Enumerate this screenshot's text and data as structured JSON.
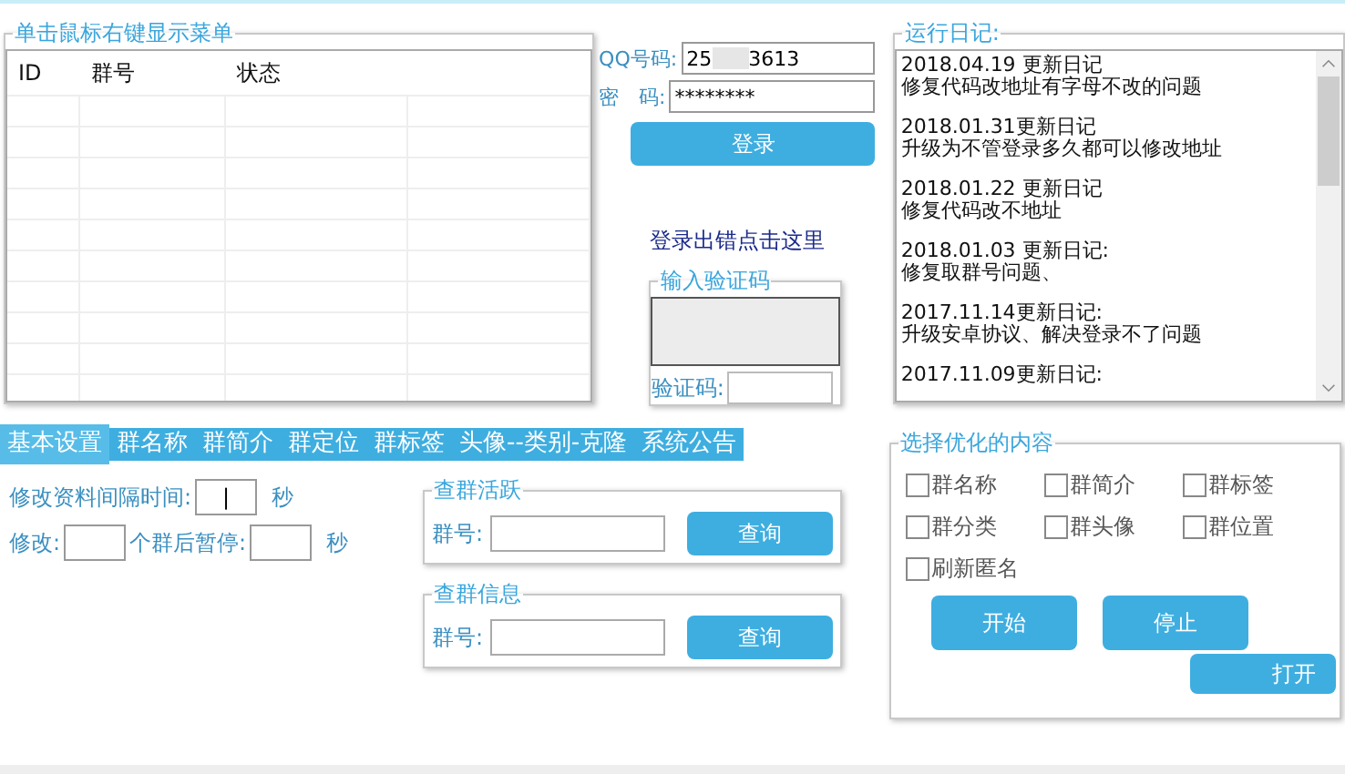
{
  "group_table": {
    "legend": "单击鼠标右键显示菜单",
    "columns": [
      "ID",
      "群号",
      "状态"
    ]
  },
  "login": {
    "qq_label": "QQ号码:",
    "qq_value_start": "25",
    "qq_value_end": "3613",
    "password_label": "密　码:",
    "password_value": "********",
    "login_button": "登录",
    "error_link": "登录出错点击这里",
    "captcha_legend": "输入验证码",
    "captcha_label": "验证码:"
  },
  "log": {
    "legend": "运行日记:",
    "entries": [
      {
        "date": "2018.04.19 更新日记",
        "text": "修复代码改地址有字母不改的问题"
      },
      {
        "date": "2018.01.31更新日记",
        "text": "升级为不管登录多久都可以修改地址"
      },
      {
        "date": "2018.01.22 更新日记",
        "text": "修复代码改不地址"
      },
      {
        "date": "2018.01.03 更新日记:",
        "text": "修复取群号问题、"
      },
      {
        "date": "2017.11.14更新日记:",
        "text": "升级安卓协议、解决登录不了问题"
      },
      {
        "date": "2017.11.09更新日记:"
      }
    ]
  },
  "tabs": [
    {
      "label": "基本设置",
      "selected": true
    },
    {
      "label": "群名称",
      "selected": false
    },
    {
      "label": "群简介",
      "selected": false
    },
    {
      "label": "群定位",
      "selected": false
    },
    {
      "label": "群标签",
      "selected": false
    },
    {
      "label": "头像--类别-克隆",
      "selected": false
    },
    {
      "label": "系统公告",
      "selected": false
    }
  ],
  "settings": {
    "interval_label": "修改资料间隔时间:",
    "interval_value": "|",
    "interval_unit": "秒",
    "modify_label": "修改:",
    "pause_label": "个群后暂停:",
    "pause_unit": "秒"
  },
  "queries": [
    {
      "legend": "查群活跃",
      "label": "群号:",
      "button": "查询"
    },
    {
      "legend": "查群信息",
      "label": "群号:",
      "button": "查询"
    }
  ],
  "options": {
    "legend": "选择优化的内容",
    "items": [
      {
        "label": "群名称",
        "checked": false
      },
      {
        "label": "群简介",
        "checked": false
      },
      {
        "label": "群标签",
        "checked": false
      },
      {
        "label": "群分类",
        "checked": false
      },
      {
        "label": "群头像",
        "checked": false
      },
      {
        "label": "群位置",
        "checked": false
      },
      {
        "label": "刷新匿名",
        "checked": false
      }
    ],
    "buttons": [
      "开始",
      "停止"
    ],
    "open_button": "打开"
  }
}
